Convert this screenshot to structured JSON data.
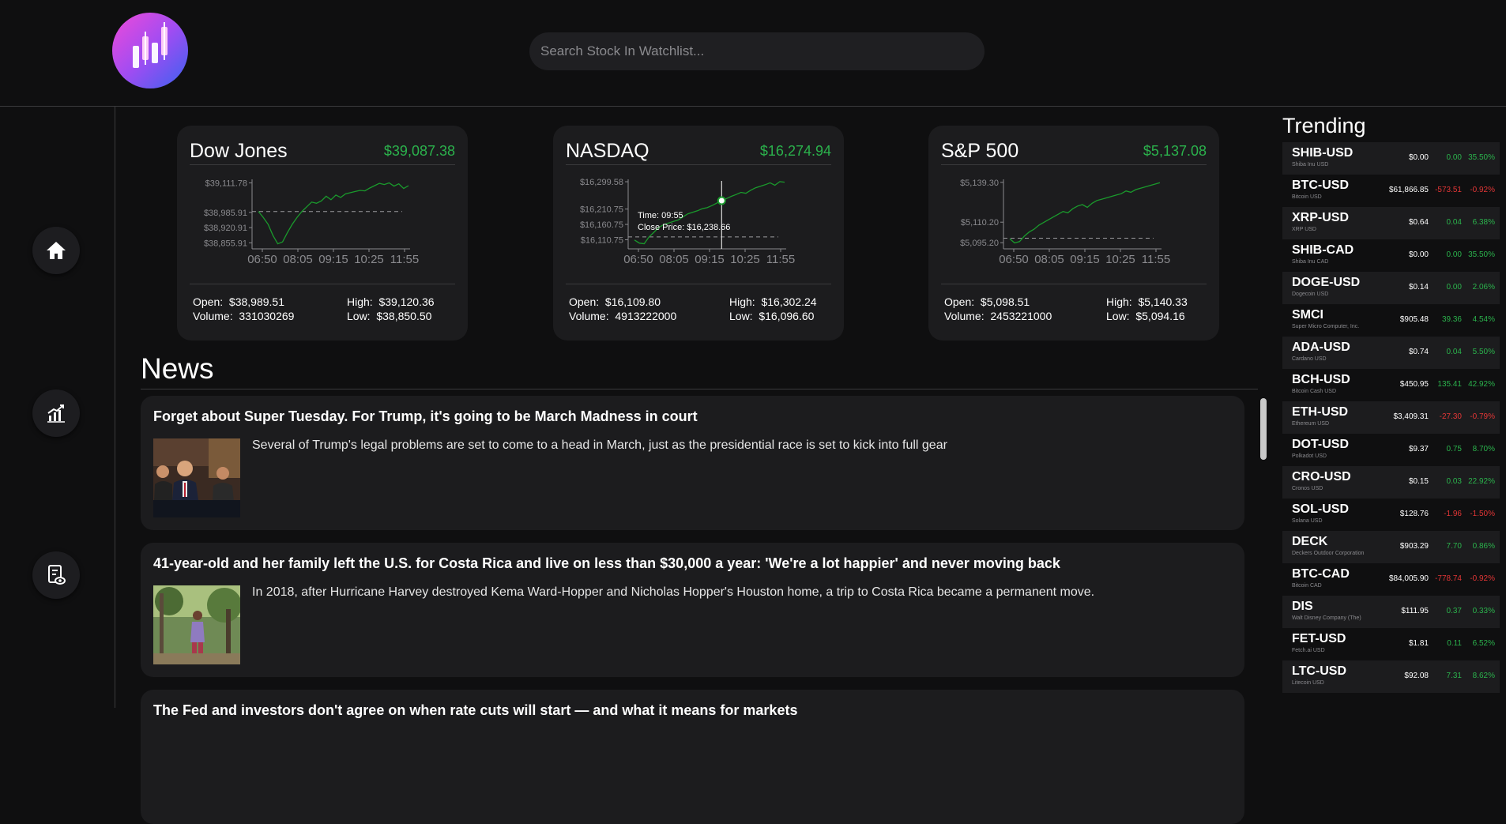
{
  "search": {
    "placeholder": "Search Stock In Watchlist..."
  },
  "colors": {
    "up": "#2bb24c",
    "down": "#e33636",
    "background": "#0f0f10",
    "card": "#1c1c1e"
  },
  "nav": {
    "items": [
      {
        "icon": "home-icon"
      },
      {
        "icon": "chart-icon"
      },
      {
        "icon": "watchlist-icon"
      }
    ]
  },
  "indices": [
    {
      "name": "Dow Jones",
      "price": "$39,087.38",
      "open_label": "Open:",
      "open": "$38,989.51",
      "high_label": "High:",
      "high": "$39,120.36",
      "volume_label": "Volume:",
      "volume": "331030269",
      "low_label": "Low:",
      "low": "$38,850.50",
      "chart_data": {
        "type": "line",
        "ytick_labels": [
          "$39,111.78",
          "$38,985.91",
          "$38,920.91",
          "$38,855.91"
        ],
        "ytick_values": [
          39111.78,
          38985.91,
          38920.91,
          38855.91
        ],
        "xtick_labels": [
          "06:50",
          "08:05",
          "09:15",
          "10:25",
          "11:55"
        ],
        "ylim": [
          38850.5,
          39120.36
        ],
        "reference_line": 38989.51,
        "series": [
          {
            "values": [
              38990,
              38965,
              38935,
              38888,
              38852,
              38860,
              38900,
              38935,
              38965,
              38990,
              39010,
              39030,
              39025,
              39035,
              39055,
              39040,
              39060,
              39050,
              39065,
              39070,
              39075,
              39080,
              39078,
              39090,
              39100,
              39110,
              39105,
              39112,
              39098,
              39108,
              39088,
              39100
            ]
          }
        ]
      }
    },
    {
      "name": "NASDAQ",
      "price": "$16,274.94",
      "open_label": "Open:",
      "open": "$16,109.80",
      "high_label": "High:",
      "high": "$16,302.24",
      "volume_label": "Volume:",
      "volume": "4913222000",
      "low_label": "Low:",
      "low": "$16,096.60",
      "tooltip": {
        "time": "Time: 09:55",
        "close": "Close Price: $16,238.66"
      },
      "tooltip_index": 18,
      "chart_data": {
        "type": "line",
        "ytick_labels": [
          "$16,299.58",
          "$16,210.75",
          "$16,160.75",
          "$16,110.75"
        ],
        "ytick_values": [
          16299.58,
          16210.75,
          16160.75,
          16110.75
        ],
        "xtick_labels": [
          "06:50",
          "08:05",
          "09:15",
          "10:25",
          "11:55"
        ],
        "ylim": [
          16096.6,
          16302.24
        ],
        "reference_line": 16120.0,
        "series": [
          {
            "values": [
              16110,
              16100,
              16098,
              16120,
              16135,
              16150,
              16160,
              16165,
              16170,
              16175,
              16185,
              16195,
              16200,
              16205,
              16212,
              16215,
              16222,
              16230,
              16238,
              16245,
              16252,
              16258,
              16265,
              16262,
              16272,
              16280,
              16285,
              16290,
              16296,
              16288,
              16300,
              16298
            ]
          }
        ]
      }
    },
    {
      "name": "S&P 500",
      "price": "$5,137.08",
      "open_label": "Open:",
      "open": "$5,098.51",
      "high_label": "High:",
      "high": "$5,140.33",
      "volume_label": "Volume:",
      "volume": "2453221000",
      "low_label": "Low:",
      "low": "$5,094.16",
      "chart_data": {
        "type": "line",
        "ytick_labels": [
          "$5,139.30",
          "$5,110.20",
          "$5,095.20"
        ],
        "ytick_values": [
          5139.3,
          5110.2,
          5095.2
        ],
        "xtick_labels": [
          "06:50",
          "08:05",
          "09:15",
          "10:25",
          "11:55"
        ],
        "ylim": [
          5094.16,
          5140.33
        ],
        "reference_line": 5098.51,
        "series": [
          {
            "values": [
              5098,
              5095,
              5096,
              5100,
              5103,
              5105,
              5108,
              5110,
              5112,
              5114,
              5116,
              5118,
              5117,
              5120,
              5122,
              5123,
              5121,
              5124,
              5126,
              5127,
              5128,
              5129,
              5130,
              5131,
              5133,
              5132,
              5134,
              5135,
              5136,
              5137,
              5138,
              5139
            ]
          }
        ]
      }
    }
  ],
  "news": {
    "title": "News",
    "items": [
      {
        "headline": "Forget about Super Tuesday. For Trump, it's going to be March Madness in court",
        "description": "Several of Trump's legal problems are set to come to a head in March, just as the presidential race is set to kick into full gear"
      },
      {
        "headline": "41-year-old and her family left the U.S. for Costa Rica and live on less than $30,000 a year: 'We're a lot happier' and never moving back",
        "description": "In 2018, after Hurricane Harvey destroyed Kema Ward-Hopper and Nicholas Hopper's Houston home, a trip to Costa Rica became a permanent move."
      },
      {
        "headline": "The Fed and investors don't agree on when rate cuts will start — and what it means for markets",
        "description": ""
      }
    ]
  },
  "trending": {
    "title": "Trending",
    "items": [
      {
        "symbol": "SHIB-USD",
        "name": "Shiba Inu USD",
        "price": "$0.00",
        "change": "0.00",
        "percent": "35.50%",
        "dir": "pos"
      },
      {
        "symbol": "BTC-USD",
        "name": "Bitcoin USD",
        "price": "$61,866.85",
        "change": "-573.51",
        "percent": "-0.92%",
        "dir": "neg"
      },
      {
        "symbol": "XRP-USD",
        "name": "XRP USD",
        "price": "$0.64",
        "change": "0.04",
        "percent": "6.38%",
        "dir": "pos"
      },
      {
        "symbol": "SHIB-CAD",
        "name": "Shiba Inu CAD",
        "price": "$0.00",
        "change": "0.00",
        "percent": "35.50%",
        "dir": "pos"
      },
      {
        "symbol": "DOGE-USD",
        "name": "Dogecoin USD",
        "price": "$0.14",
        "change": "0.00",
        "percent": "2.06%",
        "dir": "pos"
      },
      {
        "symbol": "SMCI",
        "name": "Super Micro Computer, Inc.",
        "price": "$905.48",
        "change": "39.36",
        "percent": "4.54%",
        "dir": "pos"
      },
      {
        "symbol": "ADA-USD",
        "name": "Cardano USD",
        "price": "$0.74",
        "change": "0.04",
        "percent": "5.50%",
        "dir": "pos"
      },
      {
        "symbol": "BCH-USD",
        "name": "Bitcoin Cash USD",
        "price": "$450.95",
        "change": "135.41",
        "percent": "42.92%",
        "dir": "pos"
      },
      {
        "symbol": "ETH-USD",
        "name": "Ethereum USD",
        "price": "$3,409.31",
        "change": "-27.30",
        "percent": "-0.79%",
        "dir": "neg"
      },
      {
        "symbol": "DOT-USD",
        "name": "Polkadot USD",
        "price": "$9.37",
        "change": "0.75",
        "percent": "8.70%",
        "dir": "pos"
      },
      {
        "symbol": "CRO-USD",
        "name": "Cronos USD",
        "price": "$0.15",
        "change": "0.03",
        "percent": "22.92%",
        "dir": "pos"
      },
      {
        "symbol": "SOL-USD",
        "name": "Solana USD",
        "price": "$128.76",
        "change": "-1.96",
        "percent": "-1.50%",
        "dir": "neg"
      },
      {
        "symbol": "DECK",
        "name": "Deckers Outdoor Corporation",
        "price": "$903.29",
        "change": "7.70",
        "percent": "0.86%",
        "dir": "pos"
      },
      {
        "symbol": "BTC-CAD",
        "name": "Bitcoin CAD",
        "price": "$84,005.90",
        "change": "-778.74",
        "percent": "-0.92%",
        "dir": "neg"
      },
      {
        "symbol": "DIS",
        "name": "Walt Disney Company (The)",
        "price": "$111.95",
        "change": "0.37",
        "percent": "0.33%",
        "dir": "pos"
      },
      {
        "symbol": "FET-USD",
        "name": "Fetch.ai USD",
        "price": "$1.81",
        "change": "0.11",
        "percent": "6.52%",
        "dir": "pos"
      },
      {
        "symbol": "LTC-USD",
        "name": "Litecoin USD",
        "price": "$92.08",
        "change": "7.31",
        "percent": "8.62%",
        "dir": "pos"
      }
    ]
  }
}
